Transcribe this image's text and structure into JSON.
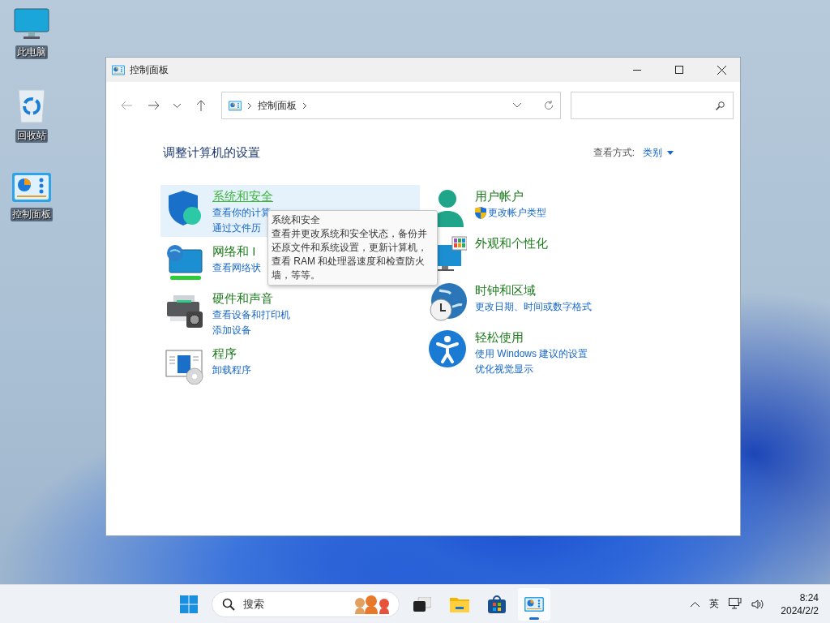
{
  "desktop_icons": [
    {
      "kind": "computer",
      "label": "此电脑"
    },
    {
      "kind": "recycle",
      "label": "回收站"
    },
    {
      "kind": "control",
      "label": "控制面板"
    }
  ],
  "window": {
    "title": "控制面板",
    "address": "控制面板",
    "heading": "调整计算机的设置",
    "view_by": {
      "label": "查看方式:",
      "value": "类别"
    },
    "left_categories": [
      {
        "kind": "security",
        "title": "系统和安全",
        "hovered": true,
        "links": [
          {
            "text": "查看你的计算",
            "shield": false
          },
          {
            "text": "通过文件历",
            "shield": false
          }
        ]
      },
      {
        "kind": "network",
        "title": "网络和 I",
        "hovered": false,
        "links": [
          {
            "text": "查看网络状",
            "shield": false
          }
        ]
      },
      {
        "kind": "hardware",
        "title": "硬件和声音",
        "hovered": false,
        "links": [
          {
            "text": "查看设备和打印机",
            "shield": false
          },
          {
            "text": "添加设备",
            "shield": false
          }
        ]
      },
      {
        "kind": "programs",
        "title": "程序",
        "hovered": false,
        "links": [
          {
            "text": "卸载程序",
            "shield": false
          }
        ]
      }
    ],
    "right_categories": [
      {
        "kind": "accounts",
        "title": "用户帐户",
        "hovered": false,
        "links": [
          {
            "text": "更改帐户类型",
            "shield": true
          }
        ]
      },
      {
        "kind": "appearance",
        "title": "外观和个性化",
        "hovered": false
      },
      {
        "kind": "clock",
        "title": "时钟和区域",
        "hovered": false,
        "links": [
          {
            "text": "更改日期、时间或数字格式",
            "shield": false
          }
        ]
      },
      {
        "kind": "ease",
        "title": "轻松使用",
        "hovered": false,
        "links": [
          {
            "text": "使用 Windows 建议的设置",
            "shield": false
          },
          {
            "text": "优化视觉显示",
            "shield": false
          }
        ]
      }
    ],
    "tooltip": {
      "title": "系统和安全",
      "text": "查看并更改系统和安全状态，备份并还原文件和系统设置，更新计算机，查看 RAM 和处理器速度和检查防火墙，等等。"
    }
  },
  "taskbar": {
    "search_placeholder": "搜索",
    "apps": [
      {
        "kind": "taskview",
        "active": false
      },
      {
        "kind": "explorer",
        "active": false
      },
      {
        "kind": "store",
        "active": false
      },
      {
        "kind": "control",
        "active": true
      }
    ],
    "ime": "英",
    "time": "8:24",
    "date": "2024/2/2"
  }
}
